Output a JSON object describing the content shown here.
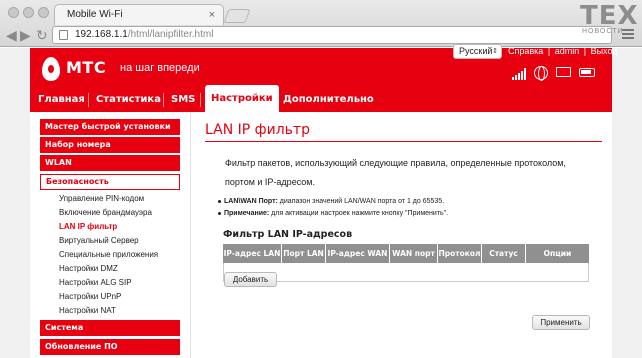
{
  "browser": {
    "tab_title": "Mobile Wi-Fi",
    "tab_close": "×",
    "url_host": "192.168.1.1",
    "url_path": "/html/lanipfilter.html",
    "back": "◀",
    "forward": "▶",
    "reload": "↻"
  },
  "watermark": {
    "brand": "TEX",
    "sub": "НОВОСТИ"
  },
  "header": {
    "logo": "МТС",
    "tagline": "на шаг впереди",
    "language": "Русский",
    "help": "Справка",
    "user": "admin",
    "logout": "Выход",
    "sep1": "|",
    "sep2": "|"
  },
  "nav": {
    "items": [
      "Главная",
      "Статистика",
      "SMS",
      "Настройки",
      "Дополнительно"
    ]
  },
  "sidebar": {
    "main_items": [
      "Мастер быстрой установки",
      "Набор номера",
      "WLAN",
      "Безопасность",
      "Система",
      "Обновление ПО"
    ],
    "sub_items": [
      "Управление PIN-кодом",
      "Включение брандмауэра",
      "LAN IP фильтр",
      "Виртуальный Сервер",
      "Специальные приложения",
      "Настройки DMZ",
      "Настройки ALG SIP",
      "Настройки UPnP",
      "Настройки NAT"
    ]
  },
  "content": {
    "title": "LAN IP фильтр",
    "description": "Фильтр пакетов, использующий следующие правила, определенные протоколом, портом и IP-адресом.",
    "note1_label": "LAN\\WAN Порт:",
    "note1_text": " диапазон значений LAN/WAN порта от 1 до 65535.",
    "note2_label": "Примечание:",
    "note2_text": " для активации настроек нажмите кнопку \"Применить\".",
    "list_title": "Фильтр LAN IP-адресов",
    "columns": [
      "IP-адрес LAN",
      "Порт LAN",
      "IP-адрес WAN",
      "WAN порт",
      "Протокол",
      "Статус",
      "Опции"
    ],
    "add_button": "Добавить",
    "apply_button": "Применить"
  },
  "colors": {
    "brand_red": "#e60010",
    "table_header": "#909090"
  }
}
